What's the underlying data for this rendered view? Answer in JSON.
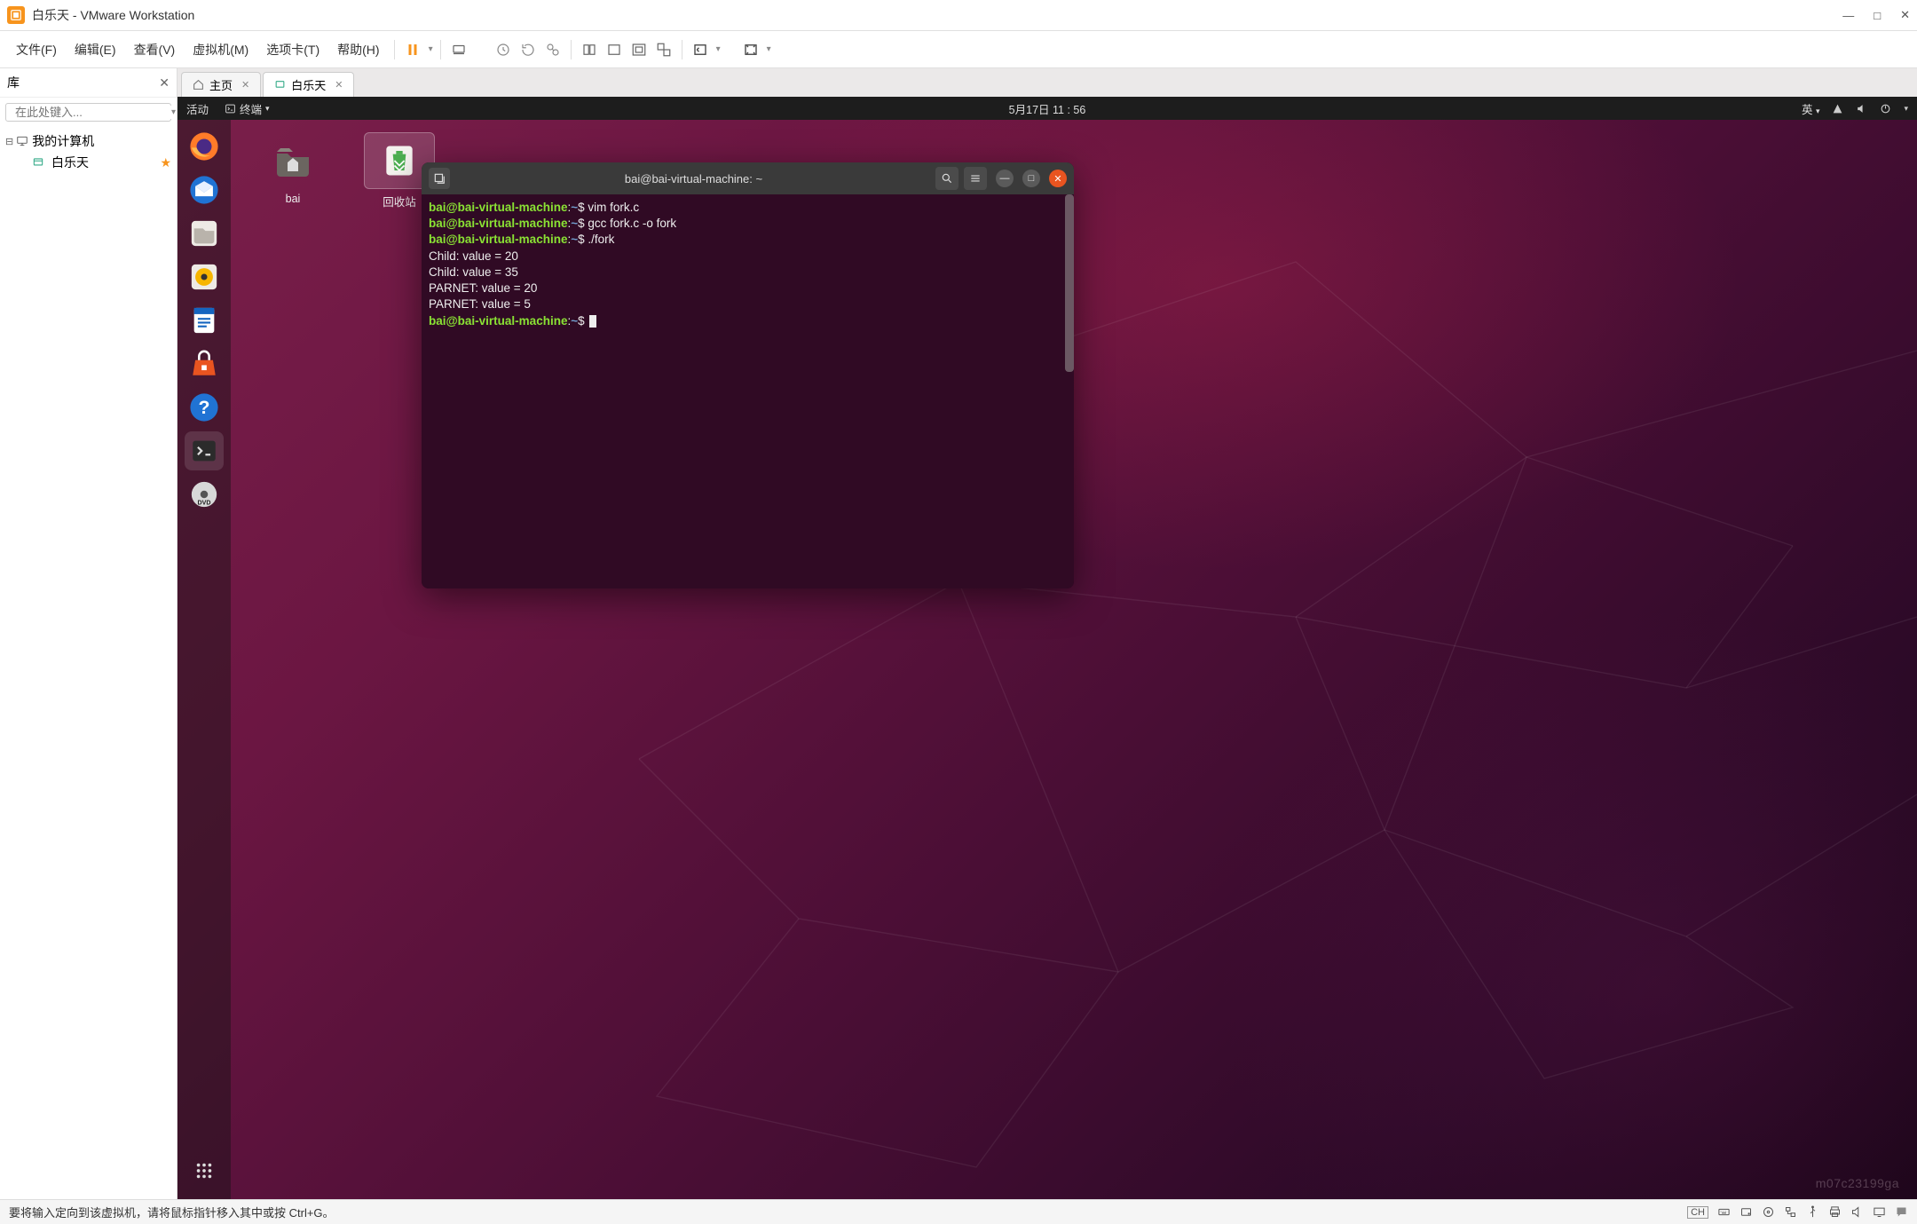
{
  "window": {
    "title": "白乐天 - VMware Workstation",
    "controls": {
      "min": "—",
      "max": "□",
      "close": "✕"
    }
  },
  "menu": {
    "file": "文件(F)",
    "edit": "编辑(E)",
    "view": "查看(V)",
    "vm": "虚拟机(M)",
    "tabs": "选项卡(T)",
    "help": "帮助(H)"
  },
  "library": {
    "title": "库",
    "search_placeholder": "在此处键入...",
    "root": "我的计算机",
    "vm": "白乐天"
  },
  "tabs": {
    "home": "主页",
    "vm": "白乐天"
  },
  "ubuntu": {
    "activities": "活动",
    "terminal_indicator": "终端",
    "datetime": "5月17日 11 : 56",
    "lang": "英",
    "desktop_icons": {
      "home": "bai",
      "trash": "回收站"
    }
  },
  "terminal": {
    "title": "bai@bai-virtual-machine: ~",
    "prompt_user": "bai@bai-virtual-machine",
    "prompt_path": "~",
    "lines": [
      {
        "type": "cmd",
        "text": "vim fork.c"
      },
      {
        "type": "cmd",
        "text": "gcc fork.c -o fork"
      },
      {
        "type": "cmd",
        "text": "./fork"
      },
      {
        "type": "out",
        "text": "Child: value = 20"
      },
      {
        "type": "out",
        "text": "Child: value = 35"
      },
      {
        "type": "out",
        "text": "PARNET: value = 20"
      },
      {
        "type": "out",
        "text": "PARNET: value = 5"
      }
    ]
  },
  "statusbar": {
    "hint": "要将输入定向到该虚拟机，请将鼠标指针移入其中或按 Ctrl+G。",
    "ime": "CH"
  },
  "watermark": "m07c23199ga"
}
